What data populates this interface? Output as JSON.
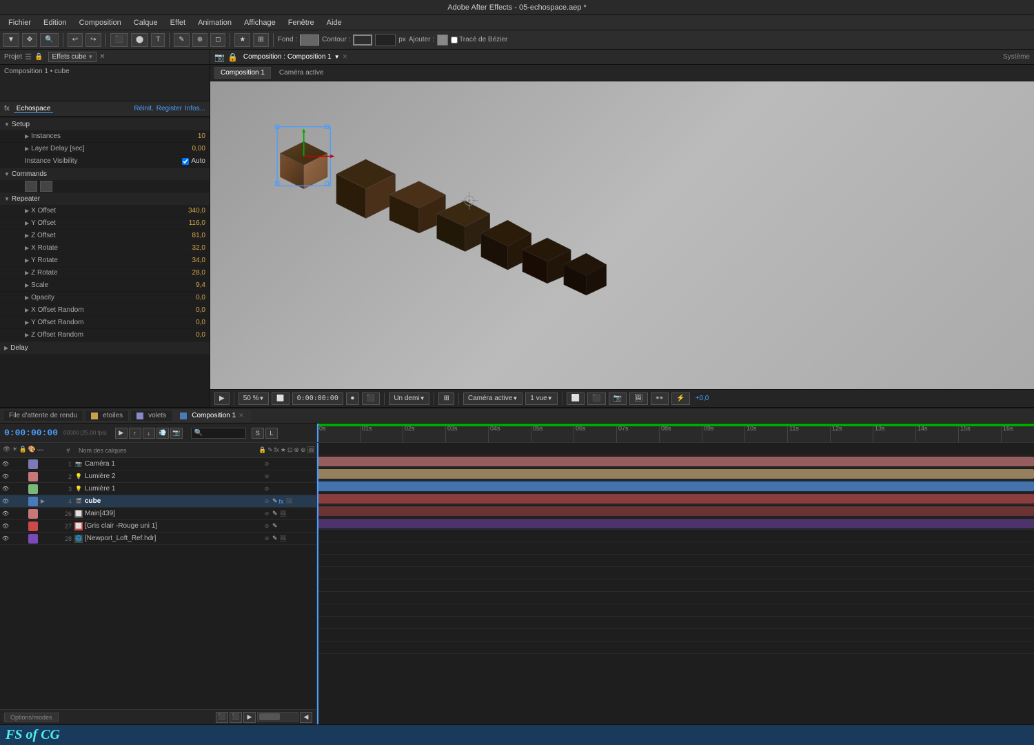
{
  "titleBar": {
    "text": "Adobe After Effects - 05-echospace.aep *"
  },
  "menuBar": {
    "items": [
      "Fichier",
      "Edition",
      "Composition",
      "Calque",
      "Effet",
      "Animation",
      "Affichage",
      "Fenêtre",
      "Aide"
    ]
  },
  "toolbar": {
    "fond_label": "Fond :",
    "contour_label": "Contour :",
    "px_label": "px",
    "ajouter_label": "Ajouter :",
    "trace_label": "Tracé de Bézier"
  },
  "projectPanel": {
    "tab": "Projet",
    "icons": [
      "☰",
      "🔒"
    ],
    "compositionName": "Effets cube",
    "breadcrumb": "Composition 1 • cube"
  },
  "effectsPanel": {
    "effectName": "Echospace",
    "tabs": {
      "reinit": "Réinit.",
      "register": "Register",
      "infos": "Infos..."
    },
    "groups": {
      "setup": {
        "label": "Setup",
        "expanded": true,
        "items": [
          {
            "label": "Instances",
            "value": "10",
            "indent": 1
          },
          {
            "label": "Layer Delay [sec]",
            "value": "0,00",
            "indent": 1
          },
          {
            "label": "Instance Visibility",
            "value": "Auto",
            "indent": 1,
            "hasCheckbox": true
          }
        ]
      },
      "commands": {
        "label": "Commands",
        "expanded": true,
        "items": []
      },
      "repeater": {
        "label": "Repeater",
        "expanded": true,
        "items": [
          {
            "label": "X Offset",
            "value": "340,0",
            "indent": 1
          },
          {
            "label": "Y Offset",
            "value": "116,0",
            "indent": 1
          },
          {
            "label": "Z Offset",
            "value": "81,0",
            "indent": 1
          },
          {
            "label": "X Rotate",
            "value": "32,0",
            "indent": 1
          },
          {
            "label": "Y Rotate",
            "value": "34,0",
            "indent": 1
          },
          {
            "label": "Z Rotate",
            "value": "28,0",
            "indent": 1
          },
          {
            "label": "Scale",
            "value": "9,4",
            "indent": 1
          },
          {
            "label": "Opacity",
            "value": "0,0",
            "indent": 1
          },
          {
            "label": "X Offset Random",
            "value": "0,0",
            "indent": 1
          },
          {
            "label": "Y Offset Random",
            "value": "0,0",
            "indent": 1
          },
          {
            "label": "Z Offset Random",
            "value": "0,0",
            "indent": 1
          }
        ]
      },
      "delay": {
        "label": "Delay",
        "expanded": false
      }
    }
  },
  "compositionPanel": {
    "headerTitle": "Composition : Composition 1",
    "tabLabel": "Composition 1",
    "cameraStatus": "Caméra active",
    "systemLabel": "Système",
    "controls": {
      "zoom": "50 %",
      "quality": "Un demi",
      "camera": "Caméra active",
      "view": "1 vue",
      "offset": "+0,0"
    }
  },
  "timeline": {
    "tabs": [
      {
        "label": "File d'attente de rendu",
        "active": false
      },
      {
        "label": "etoiles",
        "active": false
      },
      {
        "label": "volets",
        "active": false
      },
      {
        "label": "Composition 1",
        "active": true
      }
    ],
    "timecode": "0:00:00:00",
    "fps": "00000 (25,00 fps)",
    "columnHeaders": {
      "name": "Nom des calques"
    },
    "layers": [
      {
        "num": 1,
        "name": "Caméra 1",
        "type": "camera",
        "color": "#7a7ab8",
        "visible": true,
        "locked": false
      },
      {
        "num": 2,
        "name": "Lumière 2",
        "type": "light",
        "color": "#c87878",
        "visible": true,
        "locked": false
      },
      {
        "num": 3,
        "name": "Lumière 1",
        "type": "light",
        "color": "#7ab878",
        "visible": true,
        "locked": false
      },
      {
        "num": 4,
        "name": "cube",
        "type": "comp",
        "color": "#4a7ab8",
        "visible": true,
        "locked": false,
        "selected": true,
        "hasEffects": true
      },
      {
        "num": 26,
        "name": "Main[439]",
        "type": "comp",
        "color": "#c87878",
        "visible": true,
        "locked": false
      },
      {
        "num": 27,
        "name": "[Gris clair -Rouge uni 1]",
        "type": "solid",
        "color": "#c84a4a",
        "visible": true,
        "locked": false
      },
      {
        "num": 28,
        "name": "[Newport_Loft_Ref.hdr]",
        "type": "footage",
        "color": "#7a4ab8",
        "visible": true,
        "locked": false
      }
    ],
    "ruler": {
      "marks": [
        "0s",
        "01s",
        "02s",
        "03s",
        "04s",
        "05s",
        "06s",
        "07s",
        "08s",
        "09s",
        "10s",
        "11s",
        "12s",
        "13s",
        "14s",
        "15s",
        "16s"
      ]
    },
    "trackColors": {
      "1": "none",
      "2": "track-pink",
      "3": "track-tan",
      "4": "track-blue",
      "26": "track-red",
      "27": "track-red",
      "28": "track-purple"
    }
  },
  "footer": {
    "logo": "FS of CG"
  },
  "statusBar": {
    "label": "Options/modes"
  }
}
